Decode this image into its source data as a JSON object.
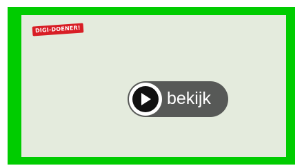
{
  "brand": {
    "badge_text": "DIGI-DOENER!",
    "badge_color": "#d81e25"
  },
  "player": {
    "play_label": "bekijk",
    "play_icon": "play-icon"
  },
  "colors": {
    "frame": "#00cc00",
    "background": "#e4ebdd",
    "pill": "#575957"
  }
}
